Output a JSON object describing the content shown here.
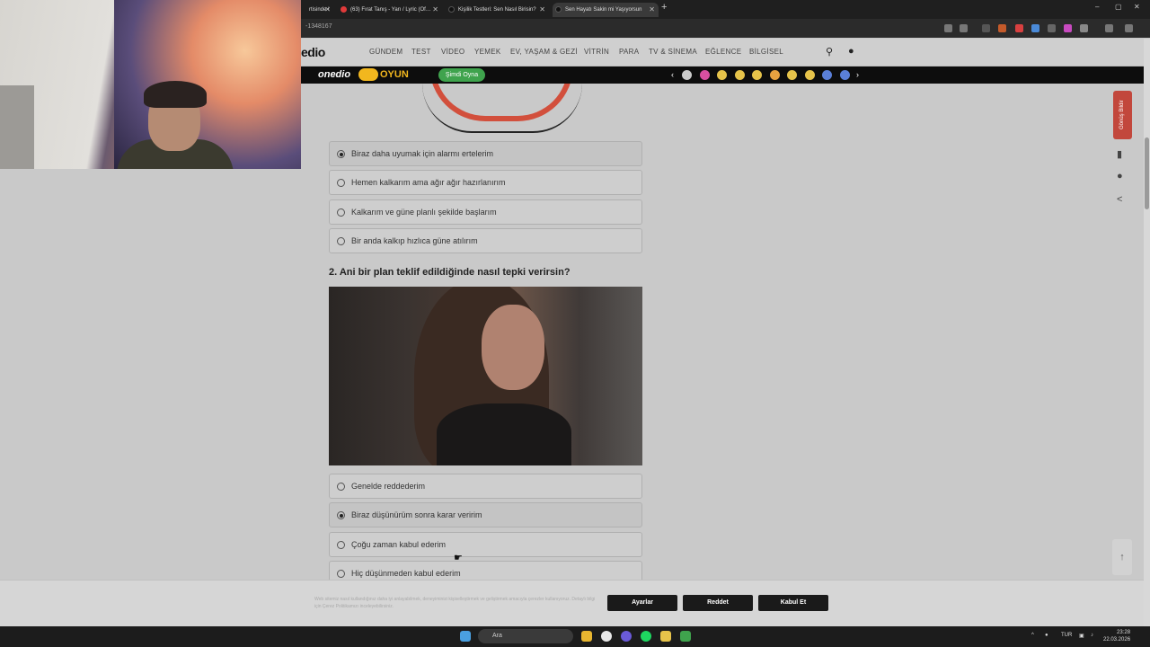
{
  "browser": {
    "tabs": [
      {
        "label": "rtisinde !",
        "icon_color": "#888"
      },
      {
        "label": "(63) Fırat Tanış - Yarı / Lyric (Of…",
        "icon_color": "#e03a3a"
      },
      {
        "label": "Kişilik Testleri: Sen Nasıl Birisin?",
        "icon_color": "#222"
      },
      {
        "label": "Sen Hayatı Sakin mi Yaşıyorsun",
        "icon_color": "#222"
      }
    ],
    "new_tab": "+",
    "url": "-1348167",
    "window_controls": [
      "–",
      "▢",
      "✕"
    ]
  },
  "site": {
    "logo": "edio",
    "nav": [
      "GÜNDEM",
      "TEST",
      "VİDEO",
      "YEMEK",
      "EV, YAŞAM & GEZİ",
      "VİTRİN",
      "PARA",
      "TV & SİNEMA",
      "EĞLENCE",
      "BİLGİSEL"
    ],
    "search_icon": "search-icon",
    "user_icon": "user-icon"
  },
  "game_bar": {
    "logo": "onedio",
    "oyun": "OYUN",
    "play": "Şimdi Oyna",
    "emoji_colors": [
      "#ccc",
      "#d74fa0",
      "#e6c34a",
      "#e6c34a",
      "#e6c34a",
      "#e6a040",
      "#e6c34a",
      "#e6c34a",
      "#5a7fd8",
      "#5a7fd8"
    ]
  },
  "quiz": {
    "q1_options": [
      {
        "label": "Biraz daha uyumak için alarmı ertelerim",
        "selected": true
      },
      {
        "label": "Hemen kalkarım ama ağır ağır hazırlanırım",
        "selected": false
      },
      {
        "label": "Kalkarım ve güne planlı şekilde başlarım",
        "selected": false
      },
      {
        "label": "Bir anda kalkıp hızlıca güne atılırım",
        "selected": false
      }
    ],
    "q2_title": "2. Ani bir plan teklif edildiğinde nasıl tepki verirsin?",
    "q2_options": [
      {
        "label": "Genelde reddederim",
        "selected": false
      },
      {
        "label": "Biraz düşünürüm sonra karar veririm",
        "selected": true
      },
      {
        "label": "Çoğu zaman kabul ederim",
        "selected": false
      },
      {
        "label": "Hiç düşünmeden kabul ederim",
        "selected": false
      }
    ]
  },
  "sidebar": {
    "report": "Gönüş Bildir",
    "bookmark_icon": "bookmark-icon",
    "comment_icon": "comment-icon",
    "share_icon": "share-icon",
    "scroll_top": "↑"
  },
  "cookie": {
    "text": "Web sitemiz nasıl kullandığınız daha iyi anlayabilmek, deneyiminizi kişiselleştirmek ve geliştirmek amacıyla çerezler kullanıyoruz. Detaylı bilgi için Çerez Politikamızı inceleyebilirsiniz.",
    "settings": "Ayarlar",
    "reject": "Reddet",
    "accept": "Kabul Et"
  },
  "taskbar": {
    "search": "Ara",
    "lang": "TUR",
    "time": "23:28",
    "date": "22.03.2026",
    "apps": [
      "#e8b630",
      "#e8e8e8",
      "#6a5ad8",
      "#1ed760",
      "#e6c34a",
      "#3fa34d"
    ]
  }
}
